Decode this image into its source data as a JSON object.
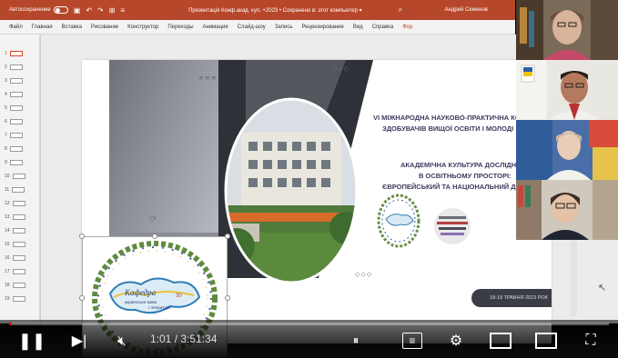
{
  "app": {
    "autosave_label": "Автосохранение",
    "doc_title": "Презентація Конф.акад. кул. +2023 • Сохранено в: этот компьютер ▾",
    "user_name": "Андрей Семенов"
  },
  "ribbon": {
    "tabs": [
      {
        "label": "Файл"
      },
      {
        "label": "Главная"
      },
      {
        "label": "Вставка"
      },
      {
        "label": "Рисование"
      },
      {
        "label": "Конструктор"
      },
      {
        "label": "Переходы"
      },
      {
        "label": "Анимация"
      },
      {
        "label": "Слайд-шоу"
      },
      {
        "label": "Запись"
      },
      {
        "label": "Рецензирование"
      },
      {
        "label": "Вид"
      },
      {
        "label": "Справка"
      },
      {
        "label": "Фор"
      }
    ]
  },
  "thumbnails": [
    "1",
    "2",
    "3",
    "4",
    "5",
    "6",
    "7",
    "8",
    "9",
    "10",
    "11",
    "12",
    "13",
    "14",
    "15",
    "16",
    "17",
    "18",
    "19"
  ],
  "slide": {
    "conf_title_line1": "VI МІЖНАРОДНА НАУКОВО-ПРАКТИЧНА КОН",
    "conf_title_line2": "ЗДОБУВАЧІВ ВИЩОЇ ОСВІТИ І МОЛОДІ",
    "subtitle_line1": "АКАДЕМІЧНА КУЛЬТУРА ДОСЛІДНИК",
    "subtitle_line2": "В ОСВІТНЬОМУ ПРОСТОРІ:",
    "subtitle_line3": "ЄВРОПЕЙСЬКИЙ ТА НАЦІОНАЛЬНИЙ ДО",
    "date": "18-19 ТРАВНЯ 2023 РОК",
    "logo_line1": "Кафедра",
    "logo_line2": "української мови",
    "logo_line3": "і літератури"
  },
  "player": {
    "time": "1:01 / 3:51:34",
    "progress_fraction": 0.004
  },
  "colors": {
    "ppt_accent": "#b7472a",
    "progress": "#ff0000"
  }
}
